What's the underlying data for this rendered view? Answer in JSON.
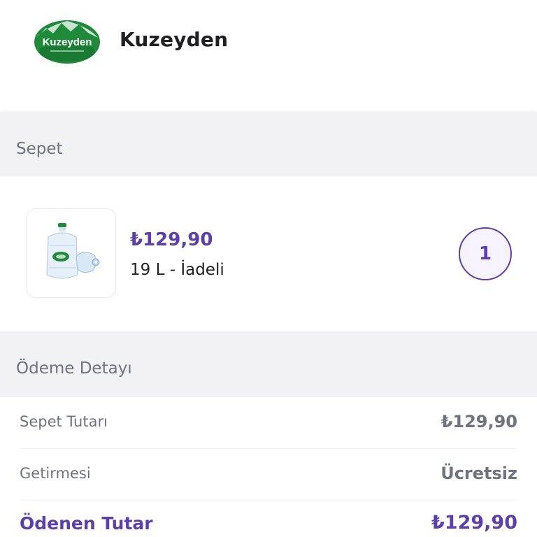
{
  "store": {
    "logo_text": "Kuzeyden",
    "name": "Kuzeyden"
  },
  "cart": {
    "section_title": "Sepet",
    "items": [
      {
        "price": "₺129,90",
        "name": "19 L - İadeli",
        "quantity": "1"
      }
    ]
  },
  "payment": {
    "section_title": "Ödeme Detayı",
    "rows": [
      {
        "label": "Sepet Tutarı",
        "value": "₺129,90"
      },
      {
        "label": "Getirmesi",
        "value": "Ücretsiz"
      },
      {
        "label": "Ödenen Tutar",
        "value": "₺129,90"
      }
    ]
  },
  "colors": {
    "accent": "#5c3fa8",
    "brand_green": "#1f8a3a",
    "section_bg": "#f2f2f4",
    "muted_text": "#6f7380"
  }
}
